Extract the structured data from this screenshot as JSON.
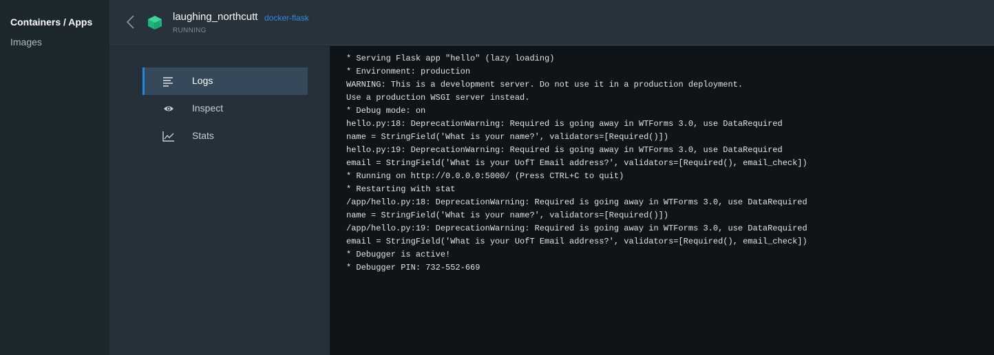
{
  "app_nav": {
    "items": [
      {
        "label": "Containers / Apps",
        "active": true
      },
      {
        "label": "Images",
        "active": false
      }
    ]
  },
  "header": {
    "container_name": "laughing_northcutt",
    "image_name": "docker-flask",
    "status": "RUNNING",
    "accent_color": "#1cb47a"
  },
  "menu": {
    "items": [
      {
        "label": "Logs",
        "icon": "logs-icon",
        "active": true
      },
      {
        "label": "Inspect",
        "icon": "eye-icon",
        "active": false
      },
      {
        "label": "Stats",
        "icon": "chart-icon",
        "active": false
      }
    ]
  },
  "logs": [
    "* Serving Flask app \"hello\" (lazy loading)",
    "* Environment: production",
    "WARNING: This is a development server. Do not use it in a production deployment.",
    "Use a production WSGI server instead.",
    "* Debug mode: on",
    "hello.py:18: DeprecationWarning: Required is going away in WTForms 3.0, use DataRequired",
    "name = StringField('What is your name?', validators=[Required()])",
    "hello.py:19: DeprecationWarning: Required is going away in WTForms 3.0, use DataRequired",
    "email = StringField('What is your UofT Email address?', validators=[Required(), email_check])",
    "* Running on http://0.0.0.0:5000/ (Press CTRL+C to quit)",
    "* Restarting with stat",
    "/app/hello.py:18: DeprecationWarning: Required is going away in WTForms 3.0, use DataRequired",
    "name = StringField('What is your name?', validators=[Required()])",
    "/app/hello.py:19: DeprecationWarning: Required is going away in WTForms 3.0, use DataRequired",
    "email = StringField('What is your UofT Email address?', validators=[Required(), email_check])",
    "* Debugger is active!",
    "* Debugger PIN: 732-552-669"
  ]
}
